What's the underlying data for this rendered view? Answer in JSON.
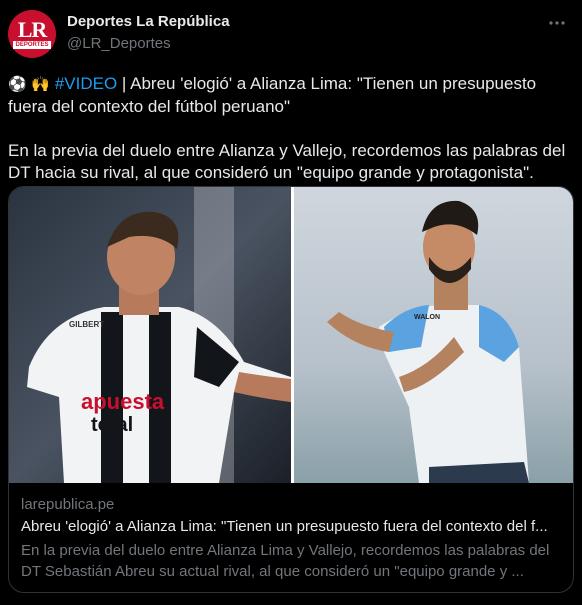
{
  "tweet": {
    "author_name": "Deportes La República",
    "author_handle": "@LR_Deportes",
    "avatar_text": "LR",
    "avatar_subtext": "DEPORTES",
    "more_icon": "more-horizontal-icon",
    "emoji_1": "⚽",
    "emoji_2": "🙌",
    "hashtag": "#VIDEO",
    "headline": " | Abreu 'elogió' a Alianza Lima: \"Tienen un presupuesto fuera del contexto del fútbol peruano\"",
    "body": "En la previa del duelo entre Alianza y Vallejo, recordemos las palabras del DT hacia su rival, al que consideró un \"equipo grande y protagonista\"."
  },
  "card": {
    "domain": "larepublica.pe",
    "title": "Abreu 'elogió' a Alianza Lima: \"Tienen un presupuesto fuera del contexto del f...",
    "description": "En la previa del duelo entre Alianza Lima y Vallejo, recordemos las palabras del DT Sebastián Abreu su actual rival, al que consideró un \"equipo grande y ...",
    "left_photo": {
      "shirt_sponsor_line1": "apuesta",
      "shirt_sponsor_line2": "total",
      "shirt_brand": "GILBERT"
    },
    "right_photo": {
      "shirt_brand": "WALON"
    }
  },
  "colors": {
    "background": "#000000",
    "text": "#e7e9ea",
    "secondary": "#71767b",
    "link": "#1d9bf0",
    "brand_red": "#c8102e",
    "border": "#2f3336"
  }
}
